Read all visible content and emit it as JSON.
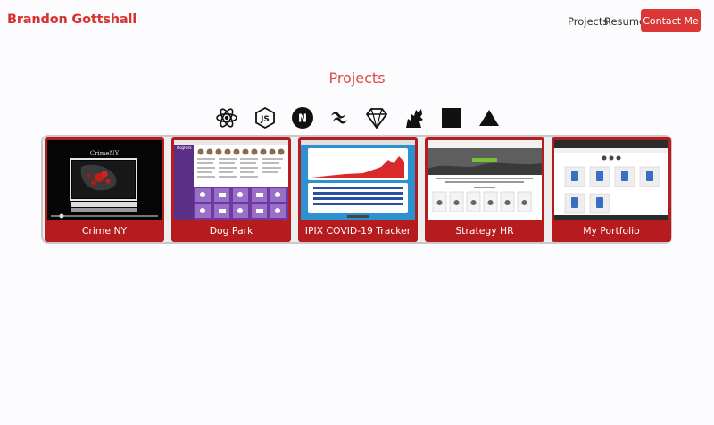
{
  "header": {
    "brand": "Brandon Gottshall",
    "nav": [
      "Projects",
      "Resume"
    ],
    "cta_label": "Contact Me"
  },
  "projects_section": {
    "title": "Projects",
    "tech_icons": [
      "react-icon",
      "nodejs-icon",
      "nextjs-icon",
      "tailwind-icon",
      "ruby-icon",
      "sass-icon",
      "square-icon",
      "vercel-icon"
    ],
    "cards": [
      {
        "title": "Crime NY",
        "thumb_text": "CrimeNY"
      },
      {
        "title": "Dog Park",
        "thumb_text": "DogPark"
      },
      {
        "title": "IPIX COVID-19 Tracker",
        "thumb_text": ""
      },
      {
        "title": "Strategy HR",
        "thumb_text": ""
      },
      {
        "title": "My Portfolio",
        "thumb_text": ""
      }
    ]
  },
  "colors": {
    "accent": "#dc3737",
    "card_bg": "#b61c1d",
    "brand_text": "#d8332f",
    "page_bg": "#fcfbfd"
  }
}
